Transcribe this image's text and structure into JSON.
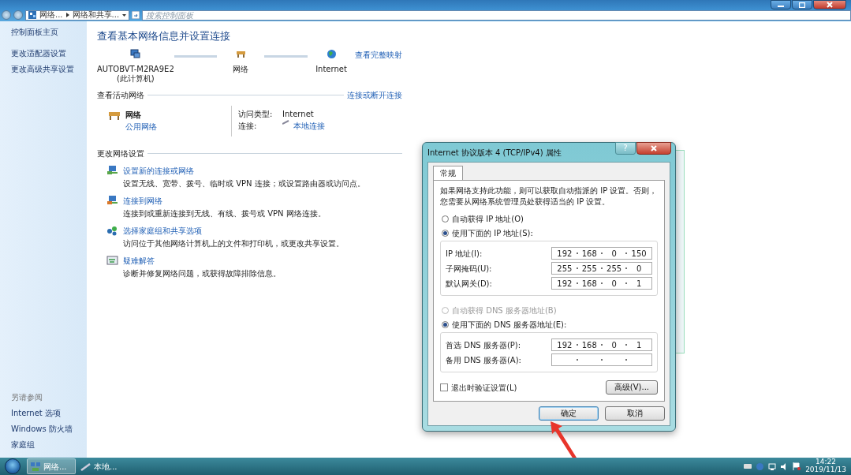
{
  "window": {
    "breadcrumb": [
      "网络...",
      "网络和共享..."
    ],
    "search": {
      "placeholder": "搜索控制面板"
    }
  },
  "sidebar": {
    "links": [
      "控制面板主页",
      "更改适配器设置",
      "更改高级共享设置"
    ],
    "see_also_title": "另请参阅",
    "see_also": [
      "Internet 选项",
      "Windows 防火墙",
      "家庭组"
    ]
  },
  "main": {
    "title": "查看基本网络信息并设置连接",
    "map_link": "查看完整映射",
    "map_nodes": [
      {
        "kind": "computer",
        "label": "AUTOBVT-M2RA9E2",
        "sublabel": "(此计算机)"
      },
      {
        "kind": "network",
        "label": "网络"
      },
      {
        "kind": "internet",
        "label": "Internet"
      }
    ],
    "active_section": {
      "title": "查看活动网络",
      "link": "连接或断开连接",
      "network_name": "网络",
      "network_type": "公用网络",
      "details": [
        {
          "label": "访问类型:",
          "value": "Internet",
          "link": false
        },
        {
          "label": "连接:",
          "value": "本地连接",
          "link": true
        }
      ]
    },
    "settings_section": {
      "title": "更改网络设置",
      "tasks": [
        {
          "kind": "new-connection",
          "title": "设置新的连接或网络",
          "desc": "设置无线、宽带、拨号、临时或 VPN 连接；或设置路由器或访问点。"
        },
        {
          "kind": "connect",
          "title": "连接到网络",
          "desc": "连接到或重新连接到无线、有线、拨号或 VPN 网络连接。"
        },
        {
          "kind": "homegroup",
          "title": "选择家庭组和共享选项",
          "desc": "访问位于其他网络计算机上的文件和打印机，或更改共享设置。"
        },
        {
          "kind": "troubleshoot",
          "title": "疑难解答",
          "desc": "诊断并修复网络问题，或获得故障排除信息。"
        }
      ]
    }
  },
  "dialog": {
    "title": "Internet 协议版本 4 (TCP/IPv4) 属性",
    "help": "?",
    "tabs": [
      {
        "label": "常规",
        "selected": true
      }
    ],
    "intro": "如果网络支持此功能，则可以获取自动指派的 IP 设置。否则，您需要从网络系统管理员处获得适当的 IP 设置。",
    "ip_mode": [
      {
        "label": "自动获得 IP 地址(O)",
        "selected": false,
        "disabled": false
      },
      {
        "label": "使用下面的 IP 地址(S):",
        "selected": true,
        "disabled": false
      }
    ],
    "ip_fields": [
      {
        "label": "IP 地址(I):",
        "octets": [
          "192",
          "168",
          "0",
          "150"
        ]
      },
      {
        "label": "子网掩码(U):",
        "octets": [
          "255",
          "255",
          "255",
          "0"
        ]
      },
      {
        "label": "默认网关(D):",
        "octets": [
          "192",
          "168",
          "0",
          "1"
        ]
      }
    ],
    "dns_mode": [
      {
        "label": "自动获得 DNS 服务器地址(B)",
        "selected": false,
        "disabled": true
      },
      {
        "label": "使用下面的 DNS 服务器地址(E):",
        "selected": true,
        "disabled": false
      }
    ],
    "dns_fields": [
      {
        "label": "首选 DNS 服务器(P):",
        "octets": [
          "192",
          "168",
          "0",
          "1"
        ]
      },
      {
        "label": "备用 DNS 服务器(A):"
      }
    ],
    "validate": {
      "label": "退出时验证设置(L)",
      "checked": false
    },
    "advanced": "高级(V)...",
    "buttons": [
      {
        "label": "确定",
        "default": true
      },
      {
        "label": "取消",
        "default": false
      }
    ]
  },
  "taskbar": {
    "items": [
      {
        "label": "网络...",
        "active": true,
        "kind": "network"
      },
      {
        "label": "本地...",
        "active": false,
        "kind": "connection"
      }
    ],
    "time": "14:22",
    "date": "2019/11/13"
  }
}
